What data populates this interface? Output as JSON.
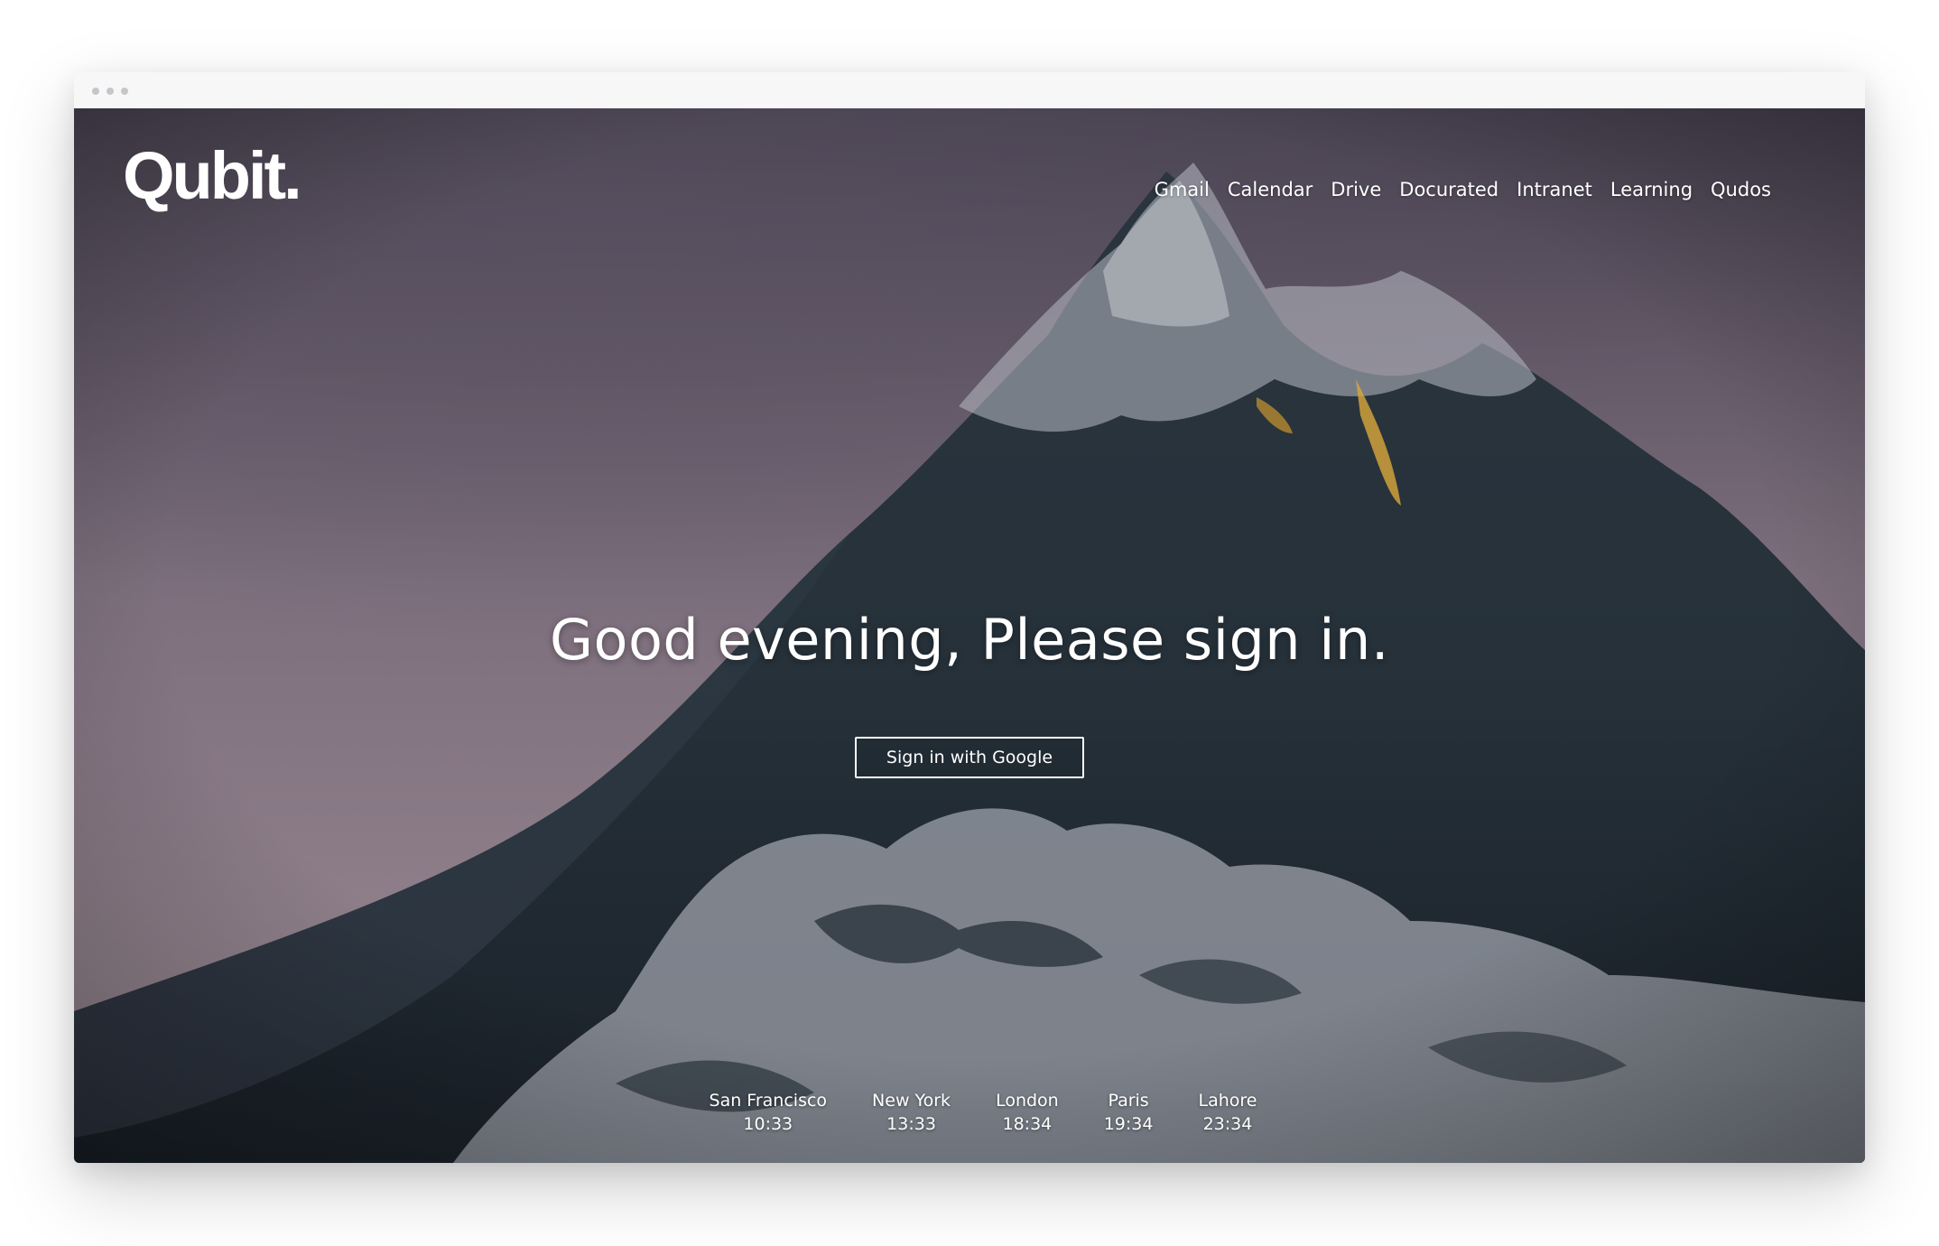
{
  "brand": {
    "logo_text": "Qubit."
  },
  "nav": {
    "items": [
      {
        "label": "Gmail"
      },
      {
        "label": "Calendar"
      },
      {
        "label": "Drive"
      },
      {
        "label": "Docurated"
      },
      {
        "label": "Intranet"
      },
      {
        "label": "Learning"
      },
      {
        "label": "Qudos"
      }
    ]
  },
  "hero": {
    "headline": "Good evening, Please sign in.",
    "signin_label": "Sign in with Google"
  },
  "clocks": [
    {
      "city": "San Francisco",
      "time": "10:33"
    },
    {
      "city": "New York",
      "time": "13:33"
    },
    {
      "city": "London",
      "time": "18:34"
    },
    {
      "city": "Paris",
      "time": "19:34"
    },
    {
      "city": "Lahore",
      "time": "23:34"
    }
  ],
  "colors": {
    "text": "#ffffff",
    "sky_top": "#4a4556",
    "sky_bottom": "#8a7d88",
    "wave_dark": "#1f2a33",
    "foam": "#b9bcc4"
  },
  "icons": [
    "window-dot-icon"
  ]
}
